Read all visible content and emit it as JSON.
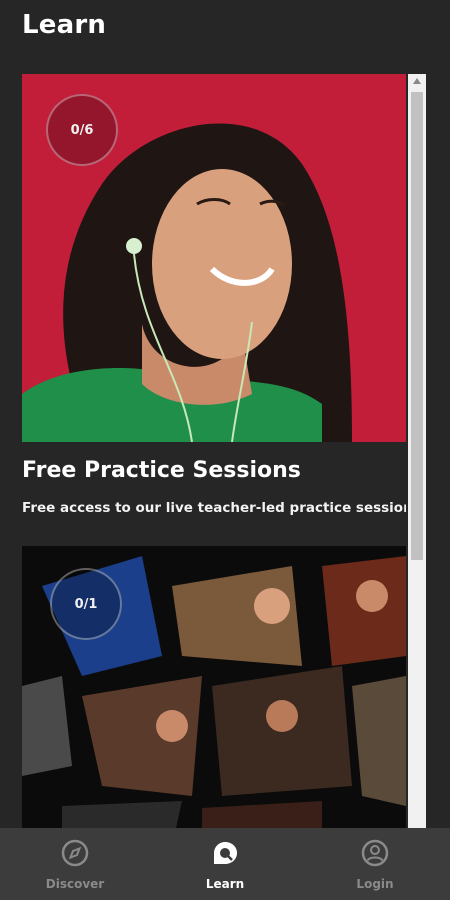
{
  "header": {
    "title": "Learn"
  },
  "cards": [
    {
      "progress": "0/6",
      "title": "Free Practice Sessions",
      "subtitle": "Free access to our live teacher-led practice sessions"
    },
    {
      "progress": "0/1"
    }
  ],
  "bottom_nav": {
    "items": [
      {
        "label": "Discover",
        "icon": "compass-icon",
        "active": false
      },
      {
        "label": "Learn",
        "icon": "learn-icon",
        "active": true
      },
      {
        "label": "Login",
        "icon": "user-icon",
        "active": false
      }
    ]
  },
  "colors": {
    "background": "#262626",
    "nav_background": "#3c3c3c",
    "hero1_background": "#c21e3a",
    "active": "#ffffff",
    "inactive": "#8a8a8a"
  }
}
